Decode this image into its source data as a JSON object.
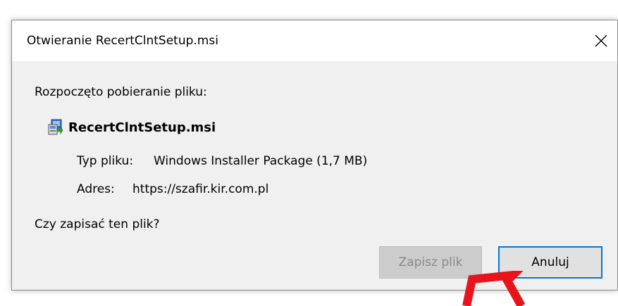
{
  "dialog": {
    "title": "Otwieranie RecertClntSetup.msi",
    "started_label": "Rozpoczęto pobieranie pliku:",
    "file_name": "RecertClntSetup.msi",
    "file_icon": "windows-installer-icon",
    "type_label": "Typ pliku:",
    "type_value": "Windows Installer Package (1,7 MB)",
    "address_label": "Adres:",
    "address_value": "https://szafir.kir.com.pl",
    "question": "Czy zapisać ten plik?",
    "save_button": "Zapisz plik",
    "save_enabled": false,
    "cancel_button": "Anuluj",
    "close_icon": "close-icon"
  },
  "annotation": {
    "color": "#e8141b"
  },
  "colors": {
    "accent": "#0078d7",
    "dialog_bg": "#f0f0f0",
    "disabled_button": "#cccccc"
  }
}
